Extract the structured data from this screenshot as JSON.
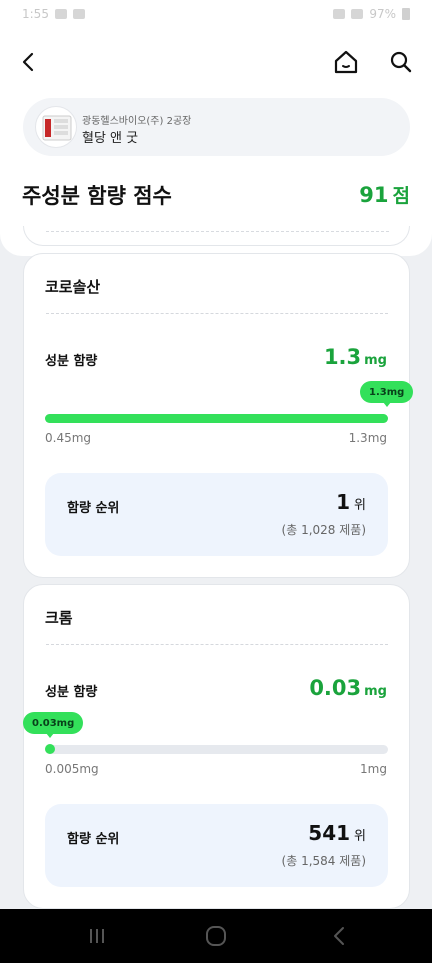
{
  "status_bar": {
    "time": "1:55",
    "battery_text": "97%"
  },
  "header": {
    "back_icon": "chevron-left-icon",
    "home_icon": "home-icon",
    "search_icon": "search-icon"
  },
  "product": {
    "company": "광동헬스바이오(주) 2공장",
    "name": "혈당 앤 굿"
  },
  "score": {
    "label": "주성분 함량 점수",
    "value": "91",
    "unit": "점"
  },
  "ingredients": [
    {
      "name": "코로솔산",
      "content_label": "성분 함량",
      "value": "1.3",
      "unit": "mg",
      "tooltip": "1.3mg",
      "range_min": "0.45mg",
      "range_max": "1.3mg",
      "fill_fraction": 1.0,
      "rank_label": "함량 순위",
      "rank_value": "1",
      "rank_unit": "위",
      "rank_total": "(총 1,028 제품)"
    },
    {
      "name": "크롬",
      "content_label": "성분 함량",
      "value": "0.03",
      "unit": "mg",
      "tooltip": "0.03mg",
      "range_min": "0.005mg",
      "range_max": "1mg",
      "fill_fraction": 0.025,
      "rank_label": "함량 순위",
      "rank_value": "541",
      "rank_unit": "위",
      "rank_total": "(총 1,584 제품)"
    }
  ],
  "colors": {
    "accent_green": "#1aa33c",
    "bar_green": "#33e05a",
    "rank_bg": "#eef4fd"
  }
}
